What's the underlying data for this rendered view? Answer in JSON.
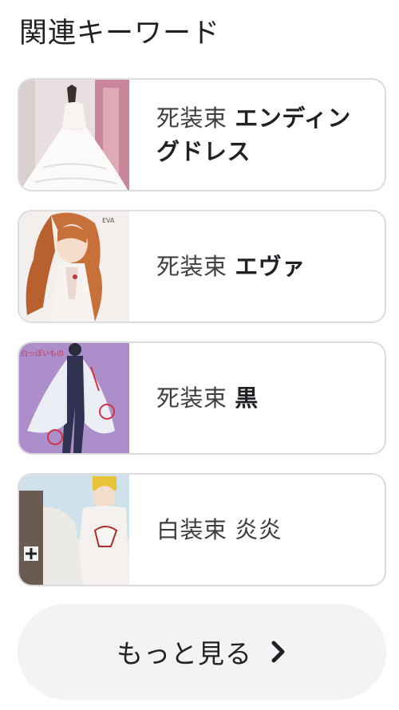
{
  "section": {
    "title": "関連キーワード"
  },
  "cards": [
    {
      "plain": "死装束 ",
      "bold": "エンディングドレス",
      "thumb": "wedding-dress-photo"
    },
    {
      "plain": "死装束 ",
      "bold": "エヴァ",
      "thumb": "anime-girl-orange-hair"
    },
    {
      "plain": "死装束 ",
      "bold": "黒",
      "thumb": "costume-sketch-purple"
    },
    {
      "plain": "白装束 炎炎",
      "bold": "",
      "thumb": "anime-characters-white-robes"
    }
  ],
  "more": {
    "label": "もっと見る",
    "icon": "chevron-right-icon"
  }
}
